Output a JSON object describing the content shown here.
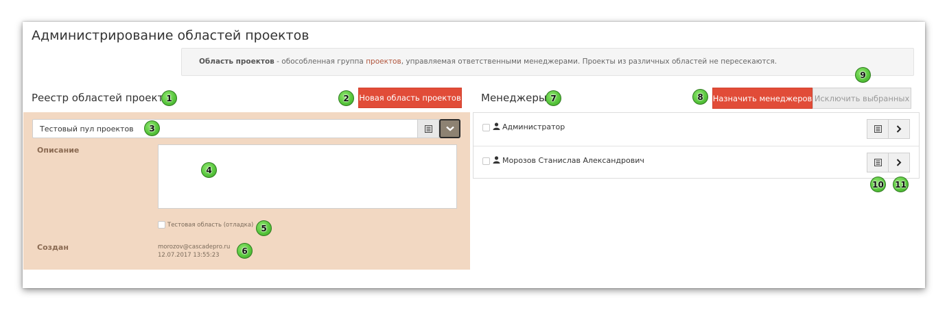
{
  "page": {
    "title": "Администрирование областей проектов"
  },
  "info": {
    "term": "Область проектов",
    "text_before_link": " - обособленная группа ",
    "link": "проектов",
    "text_after_link": ", управляемая ответственными менеджерами. Проекты из различных областей не пересекаются."
  },
  "registry": {
    "title": "Реестр областей проектов",
    "new_button": "Новая область проектов",
    "selected_pool": "Тестовый пул проектов",
    "description_label": "Описание",
    "description_value": "",
    "test_checkbox_label": "Тестовая область (отладка)",
    "test_checkbox_checked": false,
    "created_label": "Создан",
    "created_by": "morozov@cascadepro.ru",
    "created_at": "12.07.2017 13:55:23"
  },
  "managers": {
    "title": "Менеджеры",
    "assign_button": "Назначить менеджеров",
    "exclude_button": "Исключить выбранных",
    "items": [
      {
        "name": "Администратор",
        "checked": false
      },
      {
        "name": "Морозов Станислав Александрович",
        "checked": false
      }
    ]
  },
  "badges": [
    "1",
    "2",
    "3",
    "4",
    "5",
    "6",
    "7",
    "8",
    "9",
    "10",
    "11"
  ],
  "colors": {
    "accent": "#e14c38",
    "form_bg": "#f2d8c2",
    "badge": "#55c43a"
  },
  "icons": [
    "list-icon",
    "chevron-down-icon",
    "user-icon",
    "chevron-right-icon",
    "checkbox-icon"
  ]
}
